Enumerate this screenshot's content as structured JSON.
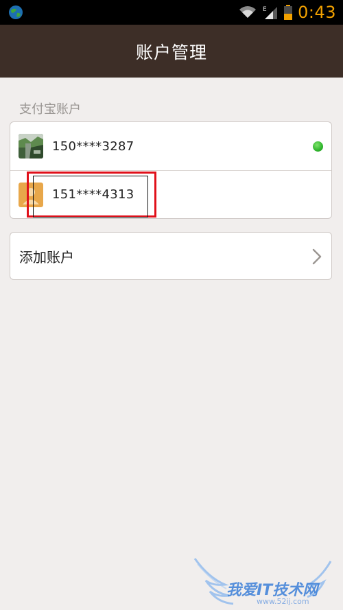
{
  "status_bar": {
    "time": "0:43",
    "network_label": "E"
  },
  "header": {
    "title": "账户管理"
  },
  "accounts_section": {
    "label": "支付宝账户",
    "accounts": [
      {
        "name": "150****3287",
        "avatar": "photo-avatar",
        "status": "online"
      },
      {
        "name": "151****4313",
        "avatar": "default-avatar"
      }
    ]
  },
  "add_account": {
    "label": "添加账户"
  },
  "watermark": {
    "text": "我爱IT技术网",
    "url": "www.52ij.com"
  },
  "colors": {
    "header_bg": "#3d2e27",
    "status_accent": "#f2a100",
    "online": "#2fb52c",
    "highlight": "#e0101a",
    "page_bg": "#f1eeed"
  }
}
